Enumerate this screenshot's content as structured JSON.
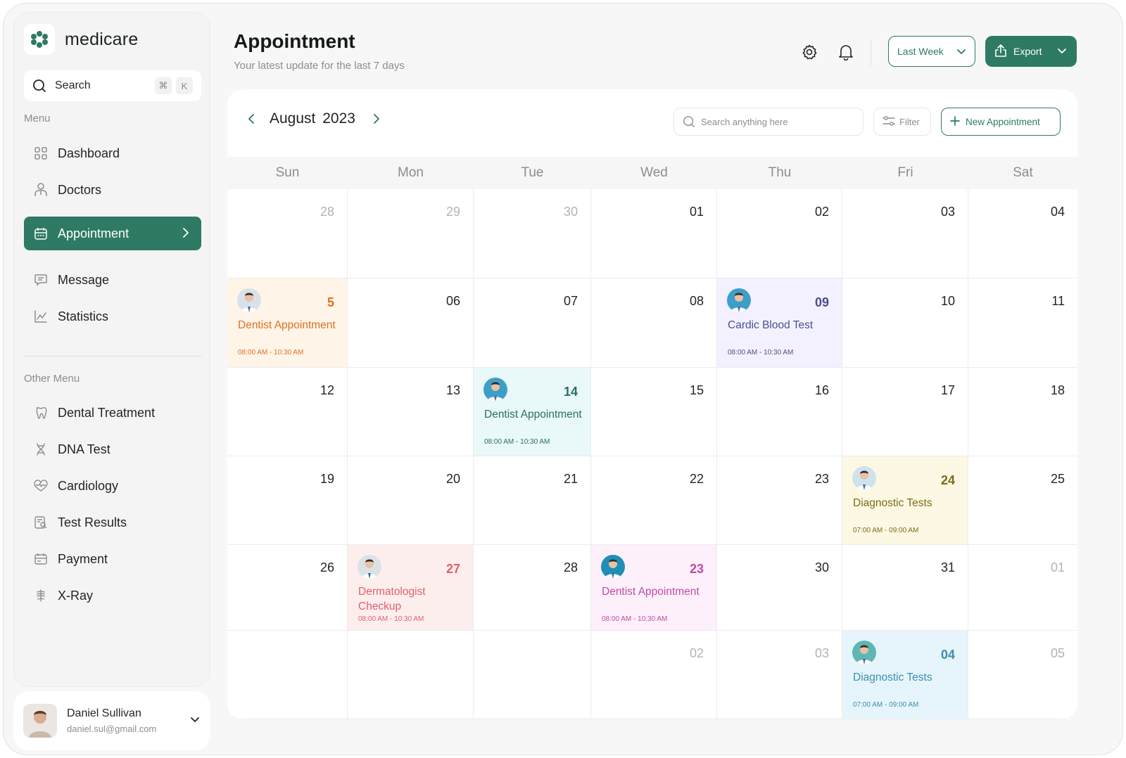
{
  "brand": {
    "name": "medicare",
    "accent": "#2e7a64"
  },
  "sidebar": {
    "search_label": "Search",
    "search_keys": [
      "⌘",
      "K"
    ],
    "menu_title": "Menu",
    "menu": [
      {
        "label": "Dashboard",
        "icon": "grid-icon"
      },
      {
        "label": "Doctors",
        "icon": "doctor-icon"
      },
      {
        "label": "Appointment",
        "icon": "calendar-icon",
        "active": true
      },
      {
        "label": "Message",
        "icon": "message-icon"
      },
      {
        "label": "Statistics",
        "icon": "chart-icon"
      }
    ],
    "other_title": "Other Menu",
    "other": [
      {
        "label": "Dental Treatment",
        "icon": "tooth-icon"
      },
      {
        "label": "DNA Test",
        "icon": "dna-icon"
      },
      {
        "label": "Cardiology",
        "icon": "heart-icon"
      },
      {
        "label": "Test Results",
        "icon": "report-icon"
      },
      {
        "label": "Payment",
        "icon": "payment-icon"
      },
      {
        "label": "X-Ray",
        "icon": "xray-icon"
      }
    ]
  },
  "user": {
    "name": "Daniel Sullivan",
    "email": "daniel.sul@gmail.com"
  },
  "header": {
    "title": "Appointment",
    "subtitle": "Your latest update for the last 7 days",
    "range_label": "Last Week",
    "export_label": "Export"
  },
  "calendar": {
    "month": "August",
    "year": "2023",
    "search_placeholder": "Search anything here",
    "filter_label": "Filter",
    "new_label": "New Appointment",
    "weekdays": [
      "Sun",
      "Mon",
      "Tue",
      "Wed",
      "Thu",
      "Fri",
      "Sat"
    ],
    "weeks": [
      [
        {
          "n": "28",
          "muted": true
        },
        {
          "n": "29",
          "muted": true
        },
        {
          "n": "30",
          "muted": true
        },
        {
          "n": "01"
        },
        {
          "n": "02"
        },
        {
          "n": "03"
        },
        {
          "n": "04"
        }
      ],
      [
        {
          "n": "5",
          "event": {
            "title": "Dentist Appointment",
            "time": "08:00 AM - 10:30 AM",
            "bg": "#fff4e8",
            "color": "#e0701f",
            "avatar": "#d8e2ea"
          }
        },
        {
          "n": "06"
        },
        {
          "n": "07"
        },
        {
          "n": "08"
        },
        {
          "n": "09",
          "event": {
            "title": "Cardic Blood Test",
            "time": "08:00 AM - 10:30 AM",
            "bg": "#f3f1ff",
            "color": "#4a4f8c",
            "avatar": "#3f9ec9"
          }
        },
        {
          "n": "10"
        },
        {
          "n": "11"
        }
      ],
      [
        {
          "n": "12"
        },
        {
          "n": "13"
        },
        {
          "n": "14",
          "event": {
            "title": "Dentist Appointment",
            "time": "08:00 AM - 10:30 AM",
            "bg": "#e9f8f8",
            "color": "#2a6f64",
            "avatar": "#3f9ec9"
          }
        },
        {
          "n": "15"
        },
        {
          "n": "16"
        },
        {
          "n": "17"
        },
        {
          "n": "18"
        }
      ],
      [
        {
          "n": "19"
        },
        {
          "n": "20"
        },
        {
          "n": "21"
        },
        {
          "n": "22"
        },
        {
          "n": "23"
        },
        {
          "n": "24",
          "event": {
            "title": "Diagnostic Tests",
            "time": "07:00 AM - 09:00 AM",
            "bg": "#fdf8e4",
            "color": "#7d6b18",
            "avatar": "#cfe3ec"
          }
        },
        {
          "n": "25"
        }
      ],
      [
        {
          "n": "26"
        },
        {
          "n": "27",
          "event": {
            "title": "Dermatologist Checkup",
            "time": "08:00 AM - 10:30 AM",
            "bg": "#fdeeee",
            "color": "#e0606a",
            "avatar": "#dbe2e7"
          }
        },
        {
          "n": "28"
        },
        {
          "n": "23",
          "event": {
            "title": "Dentist Appointment",
            "time": "08:00 AM - 10:30 AM",
            "bg": "#fdf0fa",
            "color": "#c04aa6",
            "avatar": "#1f8fb8"
          }
        },
        {
          "n": "30"
        },
        {
          "n": "31"
        },
        {
          "n": "01",
          "muted": true
        }
      ],
      [
        {
          "n": ""
        },
        {
          "n": ""
        },
        {
          "n": ""
        },
        {
          "n": "02",
          "muted": true
        },
        {
          "n": "03",
          "muted": true
        },
        {
          "n": "04",
          "event": {
            "title": "Diagnostic Tests",
            "time": "07:00 AM - 09:00 AM",
            "bg": "#e6f5fb",
            "color": "#3b8fb0",
            "avatar": "#5fb6b2"
          }
        },
        {
          "n": "05",
          "muted": true
        }
      ]
    ]
  }
}
